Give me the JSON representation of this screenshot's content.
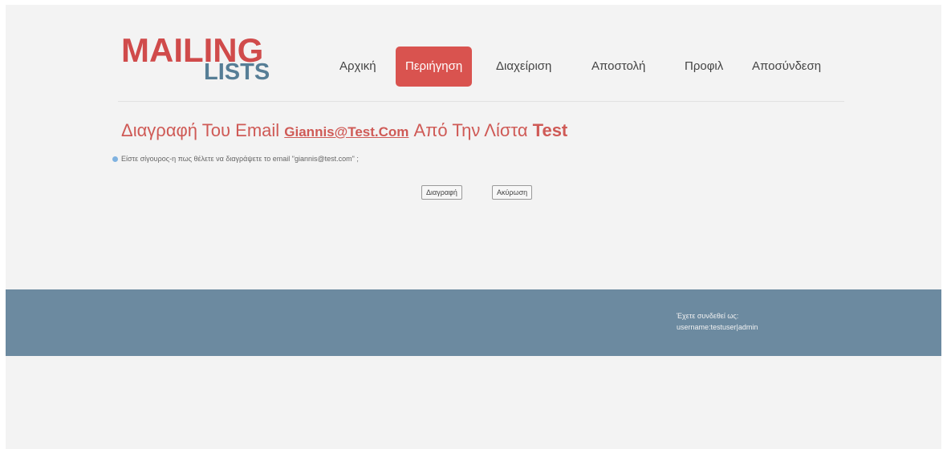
{
  "logo": {
    "line1": "MAILING",
    "line2": "LISTS"
  },
  "nav": {
    "items": [
      {
        "label": "Αρχική"
      },
      {
        "label": "Περιήγηση"
      },
      {
        "label": "Διαχείριση"
      },
      {
        "label": "Αποστολή"
      },
      {
        "label": "Προφιλ"
      },
      {
        "label": "Αποσύνδεση"
      }
    ]
  },
  "main": {
    "title_prefix": "Διαγραφή Του Email ",
    "title_email": "Giannis@Test.Com",
    "title_middle": " Από Την Λίστα ",
    "title_list": "Test",
    "question": "Είστε σίγουρος-η πως θέλετε να διαγράψετε το email \"giannis@test.com\" ;",
    "delete_button": "Διαγραφή",
    "cancel_button": "Ακύρωση"
  },
  "footer": {
    "logged_in_as": "Έχετε συνδεθεί ως:",
    "username": "username:testuser|admin"
  },
  "colors": {
    "accent_red": "#d9534f",
    "logo_blue": "#567e96",
    "footer_bg": "#6c8aa0"
  }
}
